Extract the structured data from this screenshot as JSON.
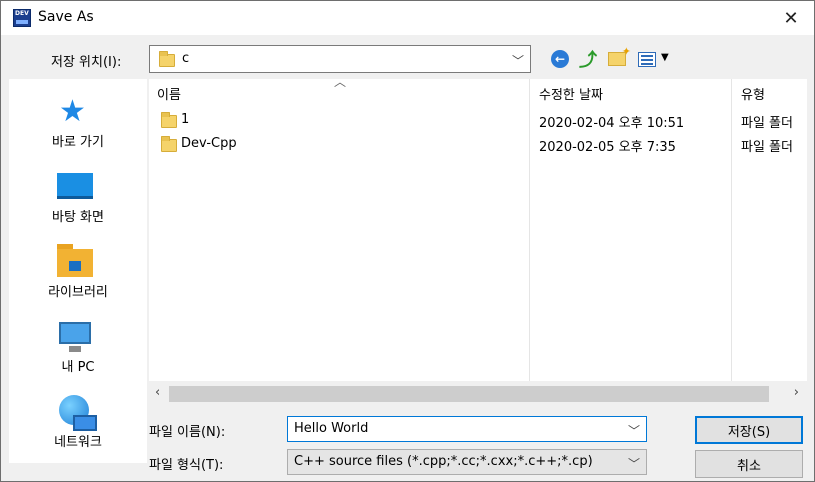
{
  "window": {
    "title": "Save As",
    "close_glyph": "✕",
    "app_icon": "dev-cpp-app-icon"
  },
  "look_in": {
    "label": "저장 위치(I):",
    "value": "c"
  },
  "toolbar": {
    "icons": [
      "back-icon",
      "up-folder-icon",
      "new-folder-icon",
      "view-menu-icon"
    ]
  },
  "places": [
    {
      "label": "바로 가기",
      "icon": "star-icon"
    },
    {
      "label": "바탕 화면",
      "icon": "desktop-icon"
    },
    {
      "label": "라이브러리",
      "icon": "library-icon"
    },
    {
      "label": "내 PC",
      "icon": "pc-icon"
    },
    {
      "label": "네트워크",
      "icon": "network-icon"
    }
  ],
  "file_list": {
    "columns": [
      "이름",
      "수정한 날짜",
      "유형"
    ],
    "rows": [
      {
        "name": "1",
        "modified": "2020-02-04 오후 10:51",
        "type": "파일 폴더"
      },
      {
        "name": "Dev-Cpp",
        "modified": "2020-02-05 오후 7:35",
        "type": "파일 폴더"
      }
    ]
  },
  "file_name": {
    "label": "파일 이름(N):",
    "value": "Hello World"
  },
  "file_type": {
    "label": "파일 형식(T):",
    "value": "C++ source files (*.cpp;*.cc;*.cxx;*.c++;*.cp)"
  },
  "buttons": {
    "save": "저장(S)",
    "cancel": "취소"
  }
}
